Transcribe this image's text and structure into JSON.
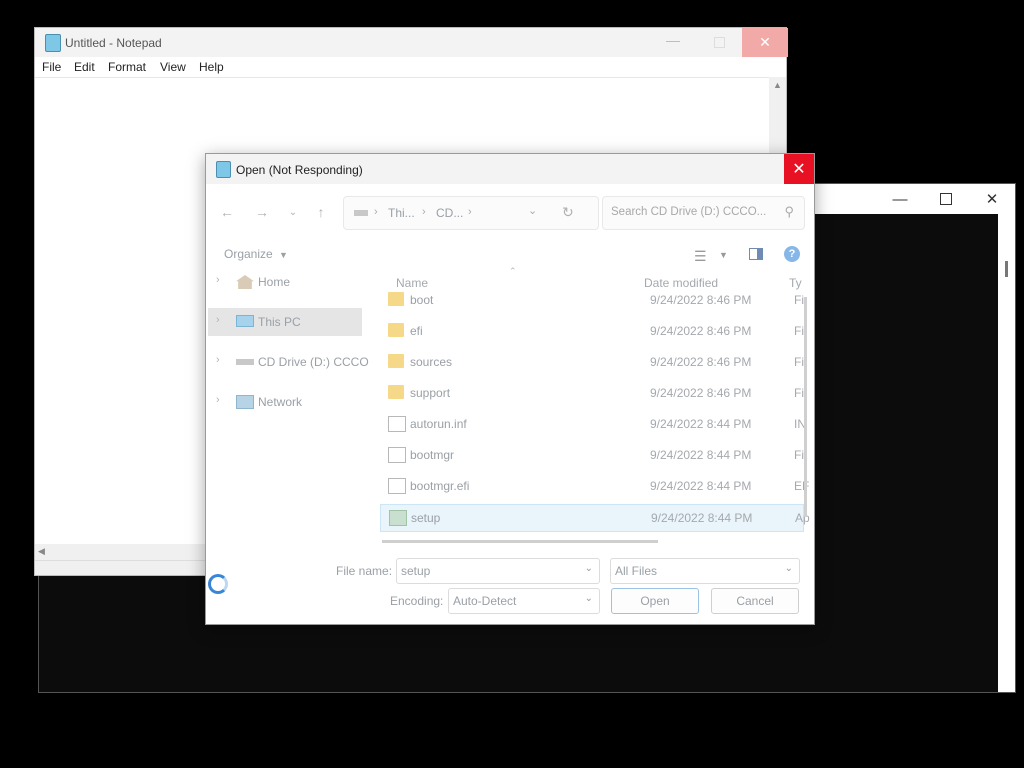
{
  "console": {
    "min_icon": "minimize-icon",
    "max_icon": "maximize-icon",
    "close_icon": "close-icon"
  },
  "notepad": {
    "title": "Untitled - Notepad",
    "menus": [
      "File",
      "Edit",
      "Format",
      "View",
      "Help"
    ]
  },
  "dialog": {
    "title": "Open (Not Responding)",
    "address": {
      "crumb1": "Thi...",
      "crumb2": "CD..."
    },
    "search_placeholder": "Search CD Drive (D:) CCCO...",
    "organize_label": "Organize",
    "nav": [
      {
        "label": "Home",
        "icon": "home-icon"
      },
      {
        "label": "This PC",
        "icon": "pc-icon"
      },
      {
        "label": "CD Drive (D:) CCCO",
        "icon": "cd-drive-icon"
      },
      {
        "label": "Network",
        "icon": "network-icon"
      }
    ],
    "columns": {
      "name": "Name",
      "date": "Date modified",
      "type": "Ty"
    },
    "files": [
      {
        "name": "boot",
        "date": "9/24/2022 8:46 PM",
        "type": "Fi",
        "icon": "folder-icon"
      },
      {
        "name": "efi",
        "date": "9/24/2022 8:46 PM",
        "type": "Fi",
        "icon": "folder-icon"
      },
      {
        "name": "sources",
        "date": "9/24/2022 8:46 PM",
        "type": "Fi",
        "icon": "folder-icon"
      },
      {
        "name": "support",
        "date": "9/24/2022 8:46 PM",
        "type": "Fi",
        "icon": "folder-icon"
      },
      {
        "name": "autorun.inf",
        "date": "9/24/2022 8:44 PM",
        "type": "IN",
        "icon": "file-icon"
      },
      {
        "name": "bootmgr",
        "date": "9/24/2022 8:44 PM",
        "type": "Fi",
        "icon": "file-icon"
      },
      {
        "name": "bootmgr.efi",
        "date": "9/24/2022 8:44 PM",
        "type": "EF",
        "icon": "file-icon"
      },
      {
        "name": "setup",
        "date": "9/24/2022 8:44 PM",
        "type": "Ap",
        "icon": "setup-app-icon",
        "selected": true
      }
    ],
    "filename_label": "File name:",
    "filename_value": "setup",
    "filter_value": "All Files",
    "encoding_label": "Encoding:",
    "encoding_value": "Auto-Detect",
    "open_label": "Open",
    "cancel_label": "Cancel"
  }
}
